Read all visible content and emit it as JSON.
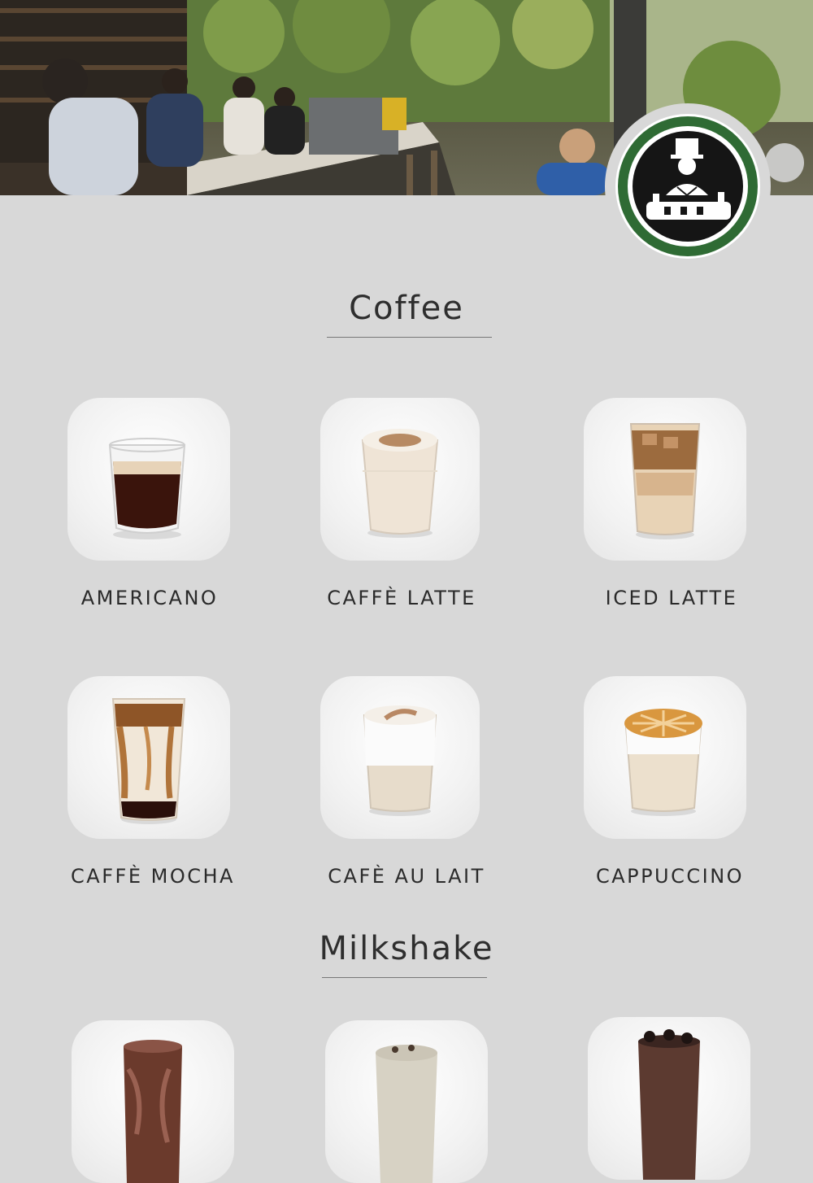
{
  "logo": {
    "name": "logo-emblem"
  },
  "sections": [
    {
      "title": "Coffee",
      "items": [
        {
          "name": "AMERICANO"
        },
        {
          "name": "CAFFÈ LATTE"
        },
        {
          "name": "ICED LATTE"
        },
        {
          "name": "CAFFÈ MOCHA"
        },
        {
          "name": "CAFÈ AU LAIT"
        },
        {
          "name": "CAPPUCCINO"
        }
      ]
    },
    {
      "title": "Milkshake",
      "items": [
        {
          "name": ""
        },
        {
          "name": ""
        },
        {
          "name": ""
        }
      ]
    }
  ],
  "colors": {
    "background": "#d8d8d8",
    "logo_green": "#2f6b34",
    "logo_dark": "#151515",
    "text": "#2a2a2a"
  }
}
